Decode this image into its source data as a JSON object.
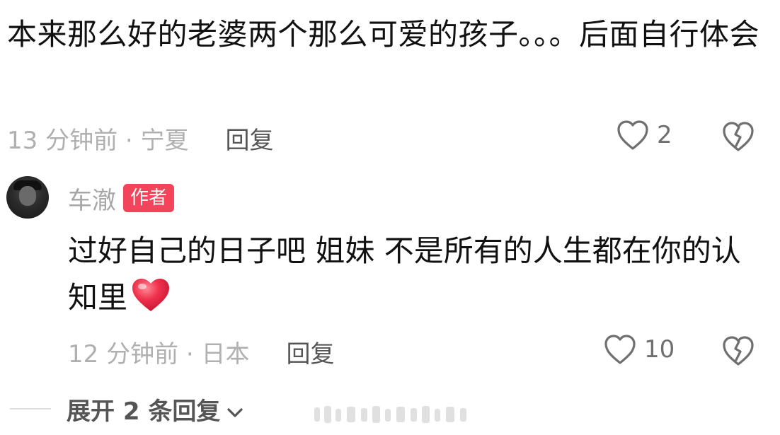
{
  "comment": {
    "text": "本来那么好的老婆两个那么可爱的孩子。。。后面自行体会",
    "time_location": "13 分钟前 · 宁夏",
    "reply_label": "回复",
    "like_count": "2"
  },
  "reply": {
    "author_name": "车澈",
    "author_badge": "作者",
    "text": "过好自己的日子吧 姐妹 不是所有的人生都在你的认知里",
    "time_location": "12 分钟前 · 日本",
    "reply_label": "回复",
    "like_count": "10"
  },
  "expand": {
    "label": "展开 2 条回复"
  },
  "icons": {
    "like": "heart-outline-icon",
    "dislike": "broken-heart-icon",
    "emoji": "red-heart-emoji",
    "expand": "chevron-down-icon"
  },
  "colors": {
    "badge": "#f2445b",
    "emoji": "#e8304a",
    "muted": "#a6a6a6"
  }
}
